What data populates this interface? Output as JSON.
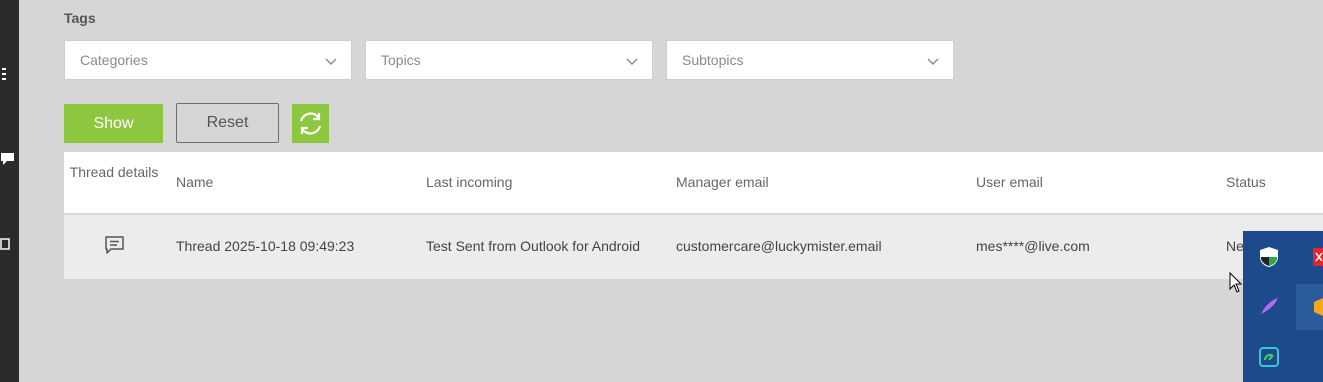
{
  "filters": {
    "tags_label": "Tags",
    "categories_placeholder": "Categories",
    "topics_placeholder": "Topics",
    "subtopics_placeholder": "Subtopics"
  },
  "actions": {
    "show_label": "Show",
    "reset_label": "Reset",
    "refresh_icon": "refresh-icon"
  },
  "table": {
    "columns": {
      "thread_details": "Thread details",
      "name": "Name",
      "last_incoming": "Last incoming",
      "manager_email": "Manager email",
      "user_email": "User email",
      "status": "Status"
    },
    "rows": [
      {
        "details_icon": "message-icon",
        "name": "Thread 2025-10-18 09:49:23",
        "last_incoming": "Test Sent from Outlook for Android",
        "manager_email": "customercare@luckymister.email",
        "user_email": "mes****@live.com",
        "status": "Ne"
      }
    ]
  },
  "colors": {
    "accent": "#8dc63f",
    "background": "#d6d6d6",
    "left_rail": "#2b2b2b",
    "tray": "#1c4a8a"
  }
}
